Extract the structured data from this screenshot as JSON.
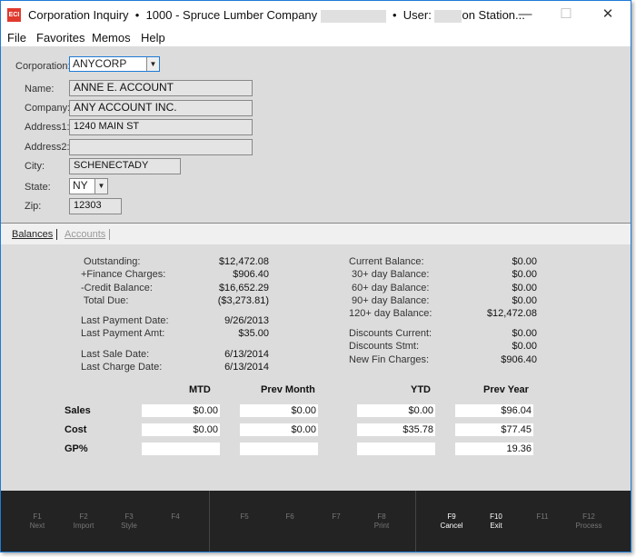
{
  "window": {
    "title": "Corporation Inquiry",
    "company": "1000 - Spruce Lumber Company",
    "user_prefix": "User:",
    "user_suffix": "on Station...",
    "logo": "ECI",
    "controls": {
      "minimize": "—",
      "maximize": "☐",
      "close": "✕"
    }
  },
  "menu": [
    "File",
    "Favorites",
    "Memos",
    "Help"
  ],
  "form": {
    "corporation": {
      "label": "Corporation:",
      "value": "ANYCORP"
    },
    "name": {
      "label": "Name:",
      "value": "ANNE E. ACCOUNT"
    },
    "company": {
      "label": "Company:",
      "value": "ANY ACCOUNT INC."
    },
    "address1": {
      "label": "Address1:",
      "value": "1240 MAIN ST"
    },
    "address2": {
      "label": "Address2:",
      "value": ""
    },
    "city": {
      "label": "City:",
      "value": "SCHENECTADY"
    },
    "state": {
      "label": "State:",
      "value": "NY"
    },
    "zip": {
      "label": "Zip:",
      "value": "12303"
    }
  },
  "tabs": [
    {
      "label": "Balances",
      "active": true
    },
    {
      "label": "Accounts",
      "active": false
    }
  ],
  "balances_left": [
    {
      "label": " Outstanding:",
      "value": "$12,472.08"
    },
    {
      "label": "+Finance Charges:",
      "value": "$906.40"
    },
    {
      "label": "-Credit Balance:",
      "value": "$16,652.29"
    },
    {
      "label": " Total Due:",
      "value": "($3,273.81)"
    },
    {
      "label": "Last Payment Date:",
      "value": "9/26/2013"
    },
    {
      "label": "Last Payment Amt:",
      "value": "$35.00"
    },
    {
      "label": "Last Sale Date:",
      "value": "6/13/2014"
    },
    {
      "label": "Last Charge Date:",
      "value": "6/13/2014"
    }
  ],
  "balances_right": [
    {
      "label": "Current Balance:",
      "value": "$0.00"
    },
    {
      "label": " 30+ day Balance:",
      "value": "$0.00"
    },
    {
      "label": " 60+ day Balance:",
      "value": "$0.00"
    },
    {
      "label": " 90+ day Balance:",
      "value": "$0.00"
    },
    {
      "label": "120+ day Balance:",
      "value": "$12,472.08"
    },
    {
      "label": "Discounts Current:",
      "value": "$0.00"
    },
    {
      "label": "Discounts Stmt:",
      "value": "$0.00"
    },
    {
      "label": "New Fin Charges:",
      "value": "$906.40"
    }
  ],
  "grid": {
    "columns": [
      "MTD",
      "Prev Month",
      "YTD",
      "Prev Year"
    ],
    "rows": [
      {
        "label": "Sales",
        "values": [
          "$0.00",
          "$0.00",
          "$0.00",
          "$96.04"
        ]
      },
      {
        "label": "Cost",
        "values": [
          "$0.00",
          "$0.00",
          "$35.78",
          "$77.45"
        ]
      },
      {
        "label": "GP%",
        "values": [
          "",
          "",
          "",
          "19.36"
        ]
      }
    ]
  },
  "fkeys": [
    {
      "key": "F1",
      "label": "Next",
      "enabled": false
    },
    {
      "key": "F2",
      "label": "Import",
      "enabled": false
    },
    {
      "key": "F3",
      "label": "Style",
      "enabled": false
    },
    {
      "key": "F4",
      "label": "",
      "enabled": false
    },
    {
      "key": "F5",
      "label": "",
      "enabled": false
    },
    {
      "key": "F6",
      "label": "",
      "enabled": false
    },
    {
      "key": "F7",
      "label": "",
      "enabled": false
    },
    {
      "key": "F8",
      "label": "Print",
      "enabled": false
    },
    {
      "key": "F9",
      "label": "Cancel",
      "enabled": true
    },
    {
      "key": "F10",
      "label": "Exit",
      "enabled": true
    },
    {
      "key": "F11",
      "label": "",
      "enabled": false
    },
    {
      "key": "F12",
      "label": "Process",
      "enabled": false
    }
  ]
}
